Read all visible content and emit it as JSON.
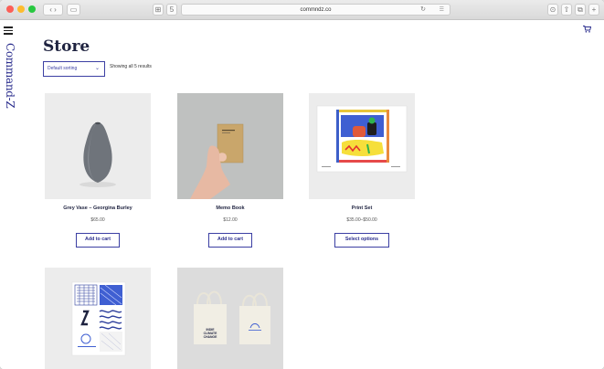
{
  "browser": {
    "url": "commndz.co",
    "reload_icon": "reload-icon",
    "tab_count": "5"
  },
  "site": {
    "logo_text": "Command-Z"
  },
  "page": {
    "title": "Store",
    "sort_selected": "Default sorting",
    "result_count": "Showing all 5 results"
  },
  "products": [
    {
      "name": "Grey Vase – Georgina Burley",
      "price": "$65.00",
      "button": "Add to cart"
    },
    {
      "name": "Memo Book",
      "price": "$12.00",
      "button": "Add to cart"
    },
    {
      "name": "Print Set",
      "price": "$35.00–$50.00",
      "button": "Select options"
    },
    {
      "name": "",
      "price": "",
      "button": ""
    },
    {
      "name": "",
      "price": "",
      "button": ""
    }
  ],
  "tote_text": "INDIE\nCLIMATE\nCHANGE",
  "colors": {
    "accent": "#2b2e8e",
    "title": "#1f2340"
  }
}
